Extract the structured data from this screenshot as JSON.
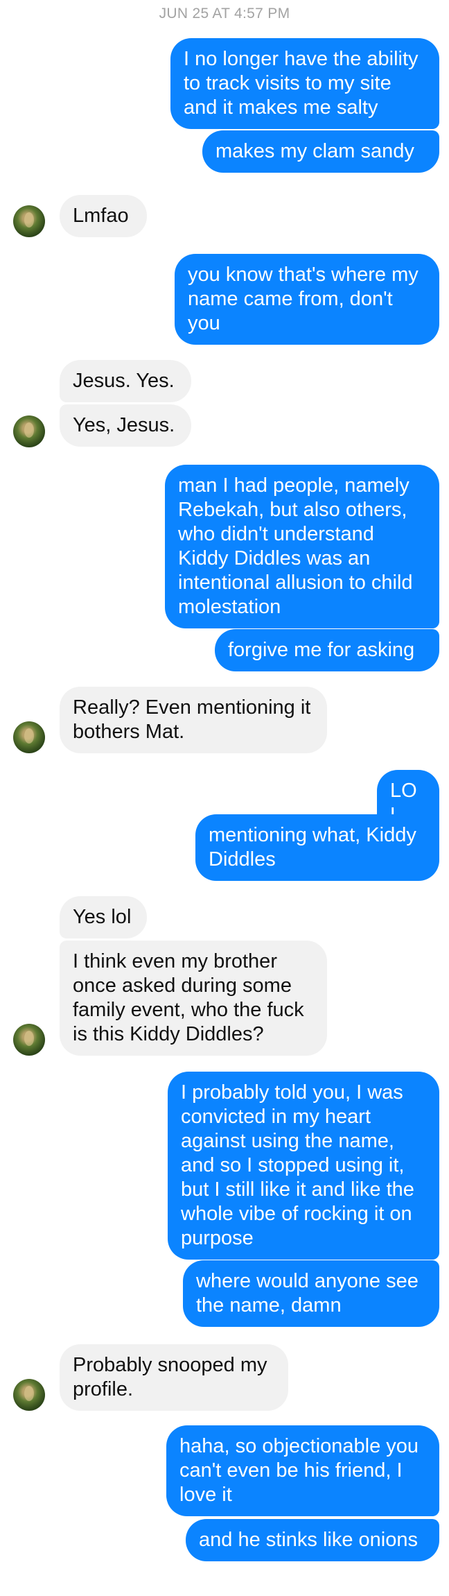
{
  "thread": {
    "timestamp": "JUN 25 AT 4:57 PM",
    "colors": {
      "outgoing_bubble": "#0b84ff",
      "incoming_bubble": "#f1f1f1",
      "timestamp_text": "#a3a3a3"
    },
    "messages": [
      {
        "from": "me",
        "text": "I no longer have the ability to track visits to my site and it makes me salty"
      },
      {
        "from": "me",
        "text": "makes my clam sandy"
      },
      {
        "from": "them",
        "text": "Lmfao"
      },
      {
        "from": "me",
        "text": "you know that's where my name came from, don't you"
      },
      {
        "from": "them",
        "text": "Jesus. Yes."
      },
      {
        "from": "them",
        "text": "Yes, Jesus."
      },
      {
        "from": "me",
        "text": "man I had people, namely Rebekah, but also others, who didn't understand Kiddy Diddles was an intentional allusion to child molestation"
      },
      {
        "from": "me",
        "text": "forgive me for asking"
      },
      {
        "from": "them",
        "text": "Really? Even mentioning it bothers Mat."
      },
      {
        "from": "me",
        "text": "LOL"
      },
      {
        "from": "me",
        "text": "mentioning what, Kiddy Diddles"
      },
      {
        "from": "them",
        "text": "Yes lol"
      },
      {
        "from": "them",
        "text": "I think even my brother once asked during some family event, who the fuck is this Kiddy Diddles?"
      },
      {
        "from": "me",
        "text": "I probably told you, I was convicted in my heart against using the name, and so I stopped using it, but I still like it and like the whole vibe of rocking it on purpose"
      },
      {
        "from": "me",
        "text": "where would anyone see the name, damn"
      },
      {
        "from": "them",
        "text": "Probably snooped my profile."
      },
      {
        "from": "me",
        "text": "haha, so objectionable you can't even be his friend, I love it"
      },
      {
        "from": "me",
        "text": "and he stinks like onions"
      }
    ]
  }
}
